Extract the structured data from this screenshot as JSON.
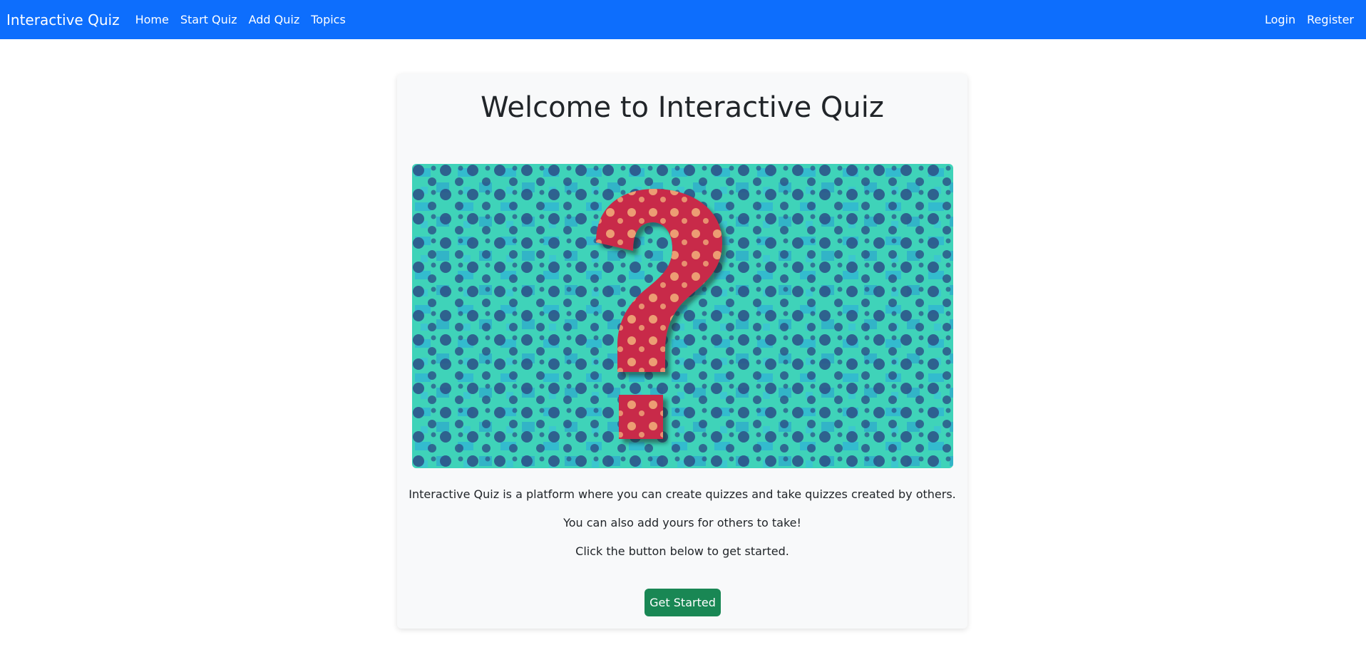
{
  "navbar": {
    "brand": "Interactive Quiz",
    "links": [
      "Home",
      "Start Quiz",
      "Add Quiz",
      "Topics"
    ],
    "auth_links": [
      "Login",
      "Register"
    ],
    "background_color": "#0d6efd"
  },
  "main": {
    "title": "Welcome to Interactive Quiz",
    "hero_image": "question-mark-illustration",
    "paragraphs": [
      "Interactive Quiz is a platform where you can create quizzes and take quizzes created by others.",
      "You can also add yours for others to take!",
      "Click the button below to get started."
    ],
    "cta_label": "Get Started",
    "cta_color": "#198754"
  }
}
